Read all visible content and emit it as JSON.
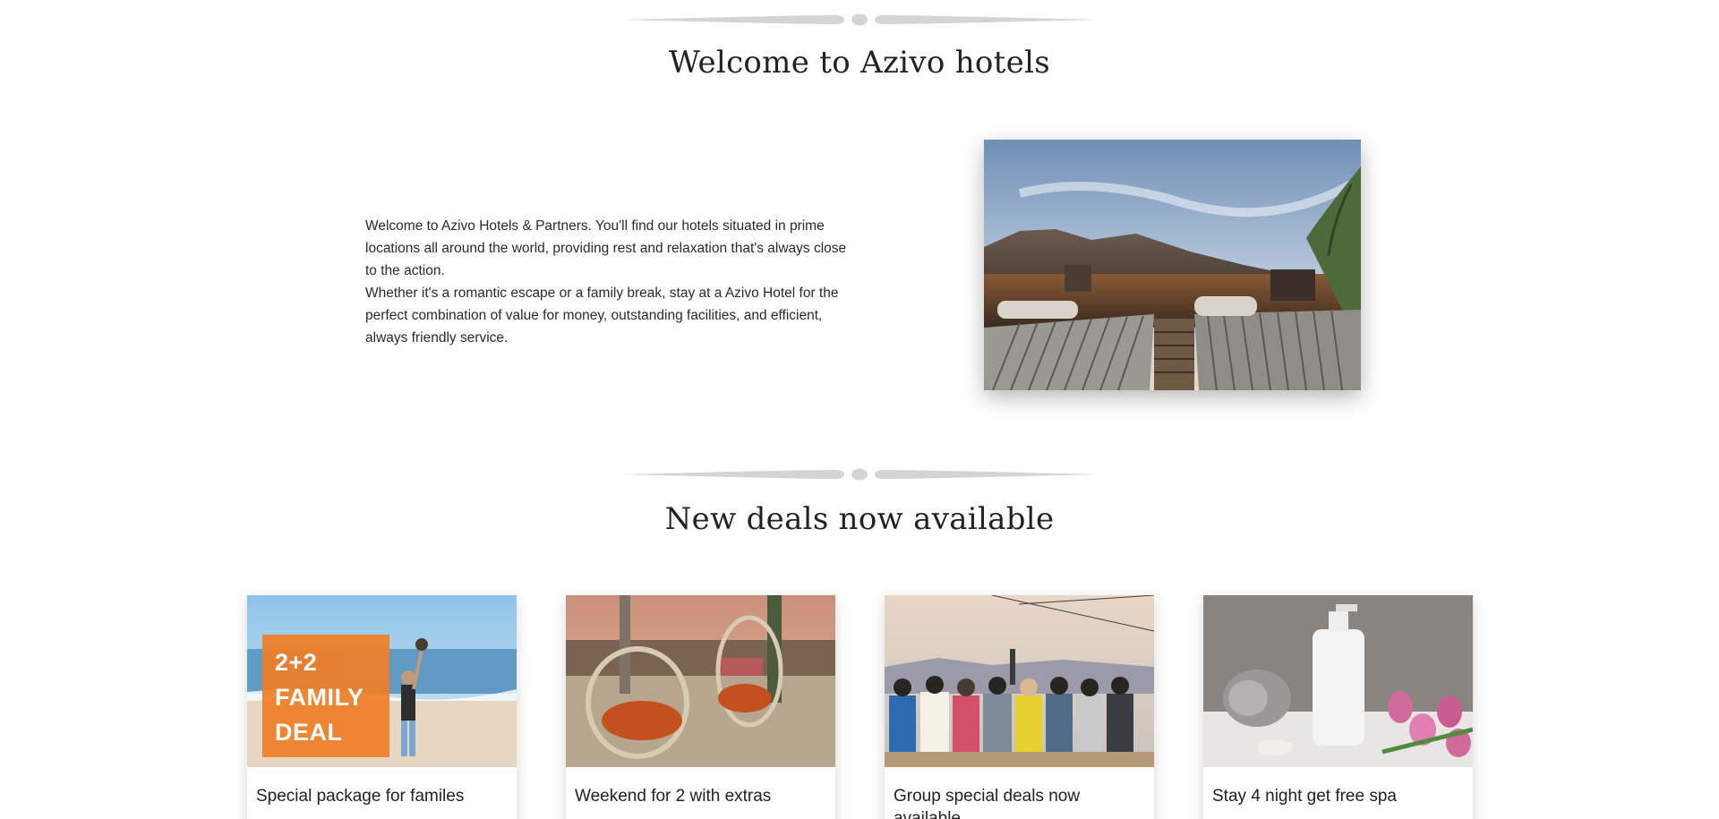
{
  "welcome": {
    "title": "Welcome to Azivo hotels",
    "paragraph_1": "Welcome to Azivo Hotels & Partners. You'll find our hotels situated in prime locations all around the world, providing rest and relaxation that's always close to the action.",
    "paragraph_2": "Whether it's a romantic escape or a family break, stay at a Azivo Hotel for the perfect combination of value for money, outstanding facilities, and efficient, always friendly service."
  },
  "deals": {
    "title": "New deals now available",
    "items": [
      {
        "caption": "Special package for familes",
        "badge_lines": [
          "2+2",
          "FAMILY",
          "DEAL"
        ]
      },
      {
        "caption": "Weekend for 2 with extras"
      },
      {
        "caption": "Group special deals now available"
      },
      {
        "caption": "Stay 4 night get free spa"
      }
    ]
  },
  "colors": {
    "badge_orange": "#f07f28",
    "divider_gray": "#d4d4d4"
  }
}
